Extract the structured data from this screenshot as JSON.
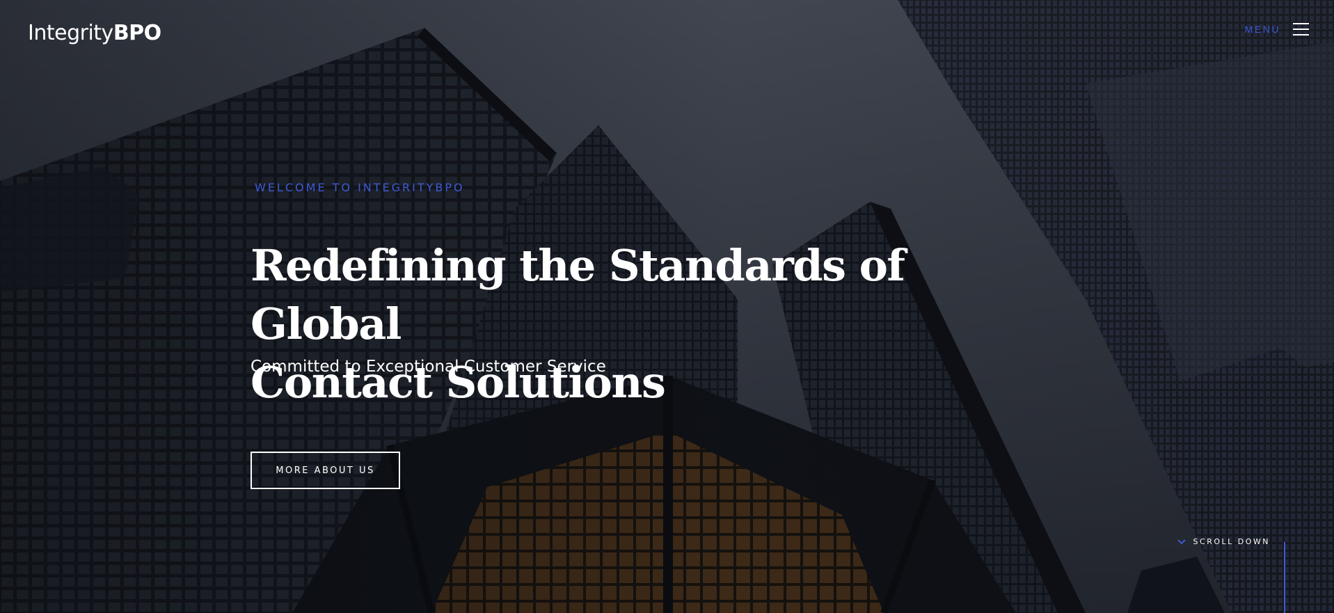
{
  "header": {
    "logo_light": "Integrity",
    "logo_bold": "BPO",
    "menu_label": "MENU"
  },
  "hero": {
    "eyebrow": "WELCOME TO INTEGRITYBPO",
    "headline_line1": "Redefining the Standards of Global",
    "headline_line2": "Contact Solutions",
    "subhead": "Committed to Exceptional Customer Service",
    "cta_label": "MORE ABOUT US"
  },
  "scroll": {
    "label": "SCROLL DOWN"
  },
  "icons": {
    "menu": "hamburger-icon",
    "scroll": "chevron-down-icon"
  },
  "colors": {
    "accent": "#3d5ad6",
    "text": "#ffffff",
    "background": "#2a2e37"
  }
}
